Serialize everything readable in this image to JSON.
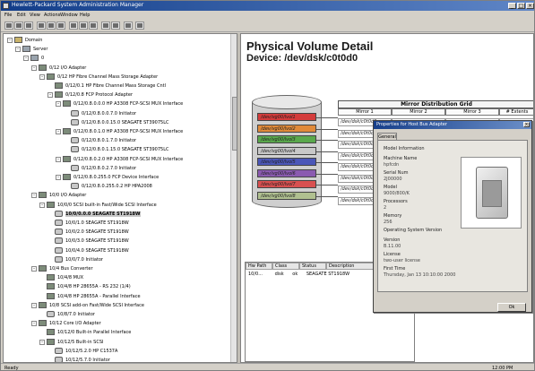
{
  "window": {
    "title": "Hewlett-Packard System Administration Manager"
  },
  "menu": [
    "File",
    "Edit",
    "View",
    "Actions",
    "Window",
    "Help"
  ],
  "toolbar_icons": [
    "new-icon",
    "open-icon",
    "save-icon",
    "print-icon",
    "back-icon",
    "forward-icon",
    "refresh-icon",
    "properties-icon",
    "find-icon",
    "map-icon",
    "grid-icon",
    "list-icon",
    "help-icon"
  ],
  "tree": {
    "nodes": [
      {
        "label": "Domain",
        "depth": 0,
        "toggle": "-",
        "icon": "folder"
      },
      {
        "label": "Server",
        "depth": 1,
        "toggle": "-",
        "icon": "server"
      },
      {
        "label": "0",
        "depth": 2,
        "toggle": "-",
        "icon": "server"
      },
      {
        "label": "0/12 I/O Adapter",
        "depth": 3,
        "toggle": "-",
        "icon": "card"
      },
      {
        "label": "0/12 HP Fibre Channel Mass Storage Adapter",
        "depth": 4,
        "toggle": "-",
        "icon": "card"
      },
      {
        "label": "0/12/0.1 HP Fibre Channel Mass Storage Cntl",
        "depth": 5,
        "toggle": "",
        "icon": "card"
      },
      {
        "label": "0/12/0.8 FCP Protocol Adapter",
        "depth": 5,
        "toggle": "-",
        "icon": "card"
      },
      {
        "label": "0/12/0.8.0.0.0 HP A3308 FCP-SCSI MUX Interface",
        "depth": 6,
        "toggle": "-",
        "icon": "card"
      },
      {
        "label": "0/12/0.8.0.0.7.0 Initiator",
        "depth": 7,
        "toggle": "",
        "icon": "dsk"
      },
      {
        "label": "0/12/0.8.0.0.15.0 SEAGATE ST39075LC",
        "depth": 7,
        "toggle": "",
        "icon": "dsk"
      },
      {
        "label": "0/12/0.8.0.1.0 HP A3308 FCP-SCSI MUX Interface",
        "depth": 6,
        "toggle": "-",
        "icon": "card"
      },
      {
        "label": "0/12/0.8.0.1.7.0 Initiator",
        "depth": 7,
        "toggle": "",
        "icon": "dsk"
      },
      {
        "label": "0/12/0.8.0.1.15.0 SEAGATE ST39075LC",
        "depth": 7,
        "toggle": "",
        "icon": "dsk"
      },
      {
        "label": "0/12/0.8.0.2.0 HP A3308 FCP-SCSI MUX Interface",
        "depth": 6,
        "toggle": "-",
        "icon": "card"
      },
      {
        "label": "0/12/0.8.0.2.7.0 Initiator",
        "depth": 7,
        "toggle": "",
        "icon": "dsk"
      },
      {
        "label": "0/12/0.8.0.255.0 FCP Device Interface",
        "depth": 6,
        "toggle": "-",
        "icon": "card"
      },
      {
        "label": "0/12/0.8.0.255.0.2 HP HPA2008",
        "depth": 7,
        "toggle": "",
        "icon": "dsk"
      },
      {
        "label": "10/0 I/O Adapter",
        "depth": 3,
        "toggle": "-",
        "icon": "card"
      },
      {
        "label": "10/0/0 SCSI built-in Fast/Wide SCSI Interface",
        "depth": 4,
        "toggle": "-",
        "icon": "card"
      },
      {
        "label": "10/0/0.0.0 SEAGATE ST1918W",
        "depth": 5,
        "toggle": "",
        "icon": "dsk",
        "selected": true
      },
      {
        "label": "10/0/1.0 SEAGATE ST1918W",
        "depth": 5,
        "toggle": "",
        "icon": "dsk"
      },
      {
        "label": "10/0/2.0 SEAGATE ST1918W",
        "depth": 5,
        "toggle": "",
        "icon": "dsk"
      },
      {
        "label": "10/0/3.0 SEAGATE ST1918W",
        "depth": 5,
        "toggle": "",
        "icon": "dsk"
      },
      {
        "label": "10/0/4.0 SEAGATE ST1918W",
        "depth": 5,
        "toggle": "",
        "icon": "dsk"
      },
      {
        "label": "10/0/7.0 Initiator",
        "depth": 5,
        "toggle": "",
        "icon": "dsk"
      },
      {
        "label": "10/4 Bus Converter",
        "depth": 3,
        "toggle": "-",
        "icon": "card"
      },
      {
        "label": "10/4/8 MUX",
        "depth": 4,
        "toggle": "",
        "icon": "card"
      },
      {
        "label": "10/4/8 HP 28655A - RS 232 (1/4)",
        "depth": 4,
        "toggle": "",
        "icon": "card"
      },
      {
        "label": "10/4/8 HP 28655A - Parallel Interface",
        "depth": 4,
        "toggle": "",
        "icon": "card"
      },
      {
        "label": "10/8 SCSI add-on Fast/Wide SCSI Interface",
        "depth": 3,
        "toggle": "-",
        "icon": "card"
      },
      {
        "label": "10/8/7.0 Initiator",
        "depth": 4,
        "toggle": "",
        "icon": "dsk"
      },
      {
        "label": "10/12 Core I/O Adapter",
        "depth": 3,
        "toggle": "-",
        "icon": "card"
      },
      {
        "label": "10/12/0 Built-in Parallel Interface",
        "depth": 4,
        "toggle": "",
        "icon": "card"
      },
      {
        "label": "10/12/5 Built-in SCSI",
        "depth": 4,
        "toggle": "-",
        "icon": "card"
      },
      {
        "label": "10/12/5.2.0 HP C1537A",
        "depth": 5,
        "toggle": "",
        "icon": "dsk"
      },
      {
        "label": "10/12/5.7.0 Initiator",
        "depth": 5,
        "toggle": "",
        "icon": "dsk"
      }
    ]
  },
  "detail": {
    "title": "Physical Volume Detail",
    "device": "Device: /dev/dsk/c0t0d0",
    "volume_bands": [
      {
        "label": "/dev/vg00/lvol1",
        "color": "#d43c3c"
      },
      {
        "label": "/dev/vg00/lvol2",
        "color": "#e08a3a"
      },
      {
        "label": "/dev/vg00/lvol3",
        "color": "#5aa84c"
      },
      {
        "label": "/dev/vg00/lvol4",
        "color": "#c8c8c8"
      },
      {
        "label": "/dev/vg00/lvol5",
        "color": "#4b57b8"
      },
      {
        "label": "/dev/vg00/lvol6",
        "color": "#8a5ab0"
      },
      {
        "label": "/dev/vg00/lvol7",
        "color": "#d85050"
      },
      {
        "label": "/dev/vg00/lvol8",
        "color": "#b0c090"
      }
    ],
    "grid": {
      "title": "Mirror Distribution Grid",
      "columns": [
        "Mirror 1",
        "Mirror 2",
        "Mirror 3",
        "# Extents"
      ],
      "rows": [
        [
          "/dev/dsk/c0t0d0",
          "",
          "",
          ""
        ],
        [
          "/dev/dsk/c0t0d0",
          "",
          "",
          ""
        ],
        [
          "/dev/dsk/c0t0d0",
          "",
          "",
          ""
        ],
        [
          "/dev/dsk/c0t0d0",
          "",
          "",
          ""
        ],
        [
          "/dev/dsk/c0t0d0",
          "",
          "",
          ""
        ],
        [
          "/dev/dsk/c0t0d0",
          "",
          "",
          ""
        ],
        [
          "/dev/dsk/c0t0d0",
          "",
          "",
          ""
        ],
        [
          "/dev/dsk/c0t0d0",
          "",
          "",
          ""
        ]
      ]
    },
    "bottom_list": {
      "columns": [
        "Hw Path",
        "Class",
        "Status",
        "Description"
      ],
      "row": [
        "10/0...",
        "disk",
        "ok",
        "SEAGATE ST1918W"
      ]
    }
  },
  "dialog": {
    "title": "Properties for Host Bus Adapter",
    "tab": "General",
    "fields": [
      {
        "k": "Model Information",
        "v": ""
      },
      {
        "k": "Machine Name",
        "v": "hpfcdn"
      },
      {
        "k": "Serial Num",
        "v": "2J00000"
      },
      {
        "k": "Model",
        "v": "9000/800/K"
      },
      {
        "k": "Processors",
        "v": "2"
      },
      {
        "k": "Memory",
        "v": "256"
      },
      {
        "k": "Operating System Version",
        "v": ""
      },
      {
        "k": "Version",
        "v": "B.11.00"
      },
      {
        "k": "License",
        "v": "two-user license"
      },
      {
        "k": "First Time",
        "v": "Thursday, Jan 13 10:10:00 2000"
      }
    ],
    "ok": "Ok"
  },
  "status": {
    "left": "Ready",
    "right": "12:00 PM"
  }
}
